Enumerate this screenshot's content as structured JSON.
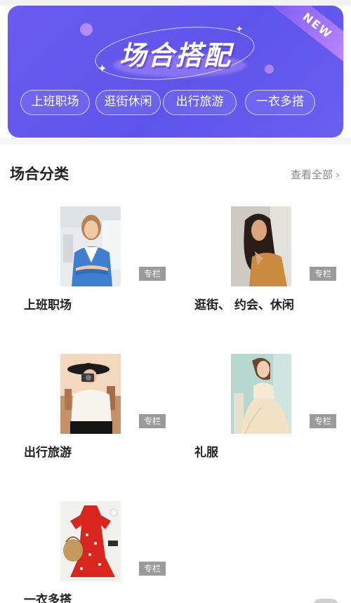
{
  "banner": {
    "title": "场合搭配",
    "badge": "NEW",
    "chips": [
      "上班职场",
      "逛街休闲",
      "出行旅游",
      "一衣多搭"
    ],
    "colors": {
      "background": "#6258ec",
      "accent": "#b48cf7"
    }
  },
  "section": {
    "title": "场合分类",
    "view_all": "查看全部",
    "view_all_icon": "chevron-right-icon"
  },
  "categories": [
    {
      "label": "上班职场",
      "tag": "专栏",
      "image": "woman in blue blazer, arms crossed, office"
    },
    {
      "label": "逛街、 约会、休闲",
      "tag": "专栏",
      "image": "woman with long dark hair in tan top"
    },
    {
      "label": "出行旅游",
      "tag": "专栏",
      "image": "woman in black hat taking photo with camera"
    },
    {
      "label": "礼服",
      "tag": "专栏",
      "image": "woman in cream evening gown"
    },
    {
      "label": "一衣多搭",
      "tag": "专栏",
      "image": "red floral dress flat lay with straw bag"
    }
  ]
}
